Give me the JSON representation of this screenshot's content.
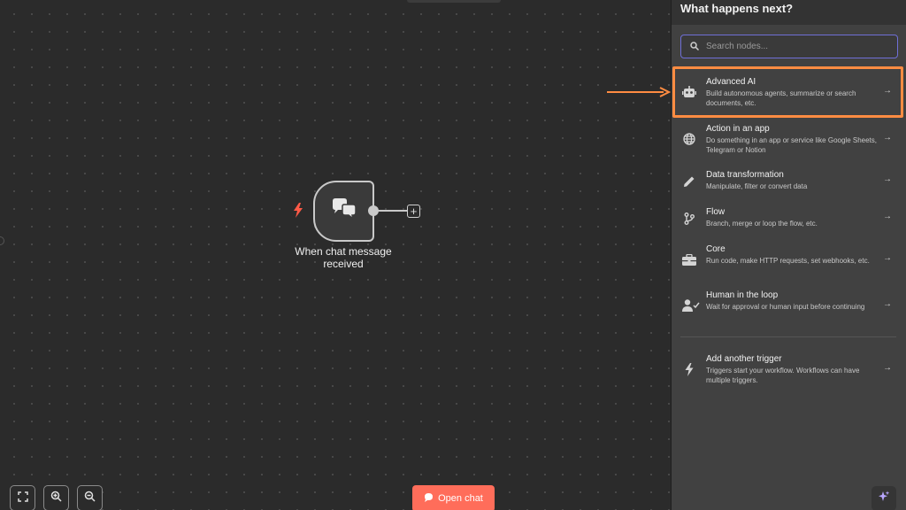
{
  "canvas": {
    "node": {
      "label": "When chat message received",
      "icon": "chat-bubbles-icon",
      "trigger_icon": "lightning-bolt-icon"
    },
    "add_node_label": "+",
    "open_chat_label": "Open chat",
    "controls": [
      "fit-view-icon",
      "zoom-in-icon",
      "zoom-out-icon"
    ]
  },
  "panel": {
    "title": "What happens next?",
    "search": {
      "placeholder": "Search nodes...",
      "value": ""
    },
    "items": [
      {
        "title": "Advanced AI",
        "desc": "Build autonomous agents, summarize or search documents, etc.",
        "icon": "robot-icon"
      },
      {
        "title": "Action in an app",
        "desc": "Do something in an app or service like Google Sheets, Telegram or Notion",
        "icon": "globe-icon"
      },
      {
        "title": "Data transformation",
        "desc": "Manipulate, filter or convert data",
        "icon": "pencil-icon"
      },
      {
        "title": "Flow",
        "desc": "Branch, merge or loop the flow, etc.",
        "icon": "branch-icon"
      },
      {
        "title": "Core",
        "desc": "Run code, make HTTP requests, set webhooks, etc.",
        "icon": "toolbox-icon"
      },
      {
        "title": "Human in the loop",
        "desc": "Wait for approval or human input before continuing",
        "icon": "user-check-icon"
      },
      {
        "title": "Add another trigger",
        "desc": "Triggers start your workflow. Workflows can have multiple triggers.",
        "icon": "lightning-bolt-icon"
      }
    ]
  },
  "colors": {
    "accent": "#ff6d5a",
    "highlight": "#ff8c42",
    "search_border": "#6f6fd6",
    "panel_bg": "#414141",
    "canvas_bg": "#2b2b2b"
  }
}
